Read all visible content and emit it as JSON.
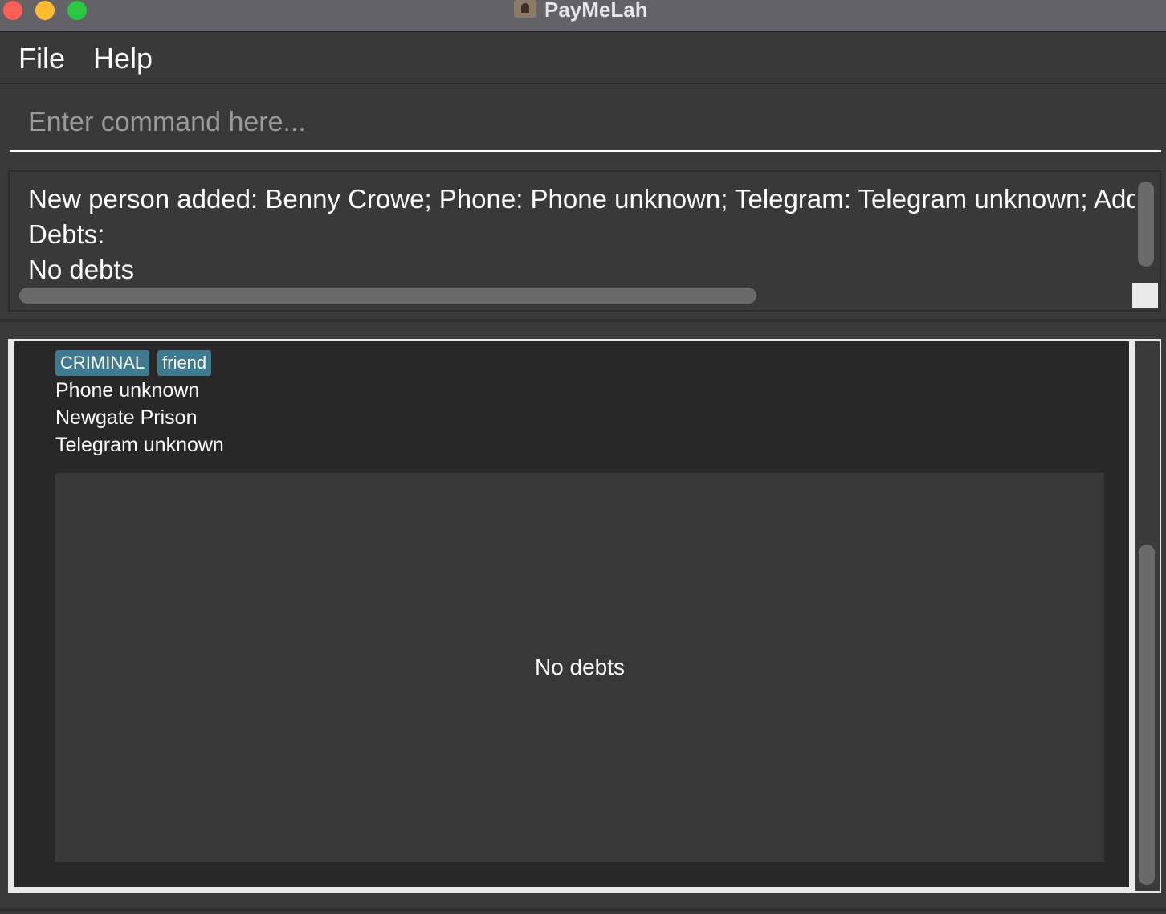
{
  "window": {
    "title": "PayMeLah"
  },
  "menu": {
    "file": "File",
    "help": "Help"
  },
  "command": {
    "placeholder": "Enter command here..."
  },
  "result": {
    "lines": [
      "New person added: Benny Crowe; Phone: Phone unknown; Telegram: Telegram unknown; Address: Newgate Prison; Tags: [CRIMINAL][friend]",
      "Debts:",
      "No debts"
    ]
  },
  "person": {
    "tags": [
      "CRIMINAL",
      "friend"
    ],
    "phone": "Phone unknown",
    "address": "Newgate Prison",
    "telegram": "Telegram unknown",
    "debts_empty_text": "No debts"
  }
}
